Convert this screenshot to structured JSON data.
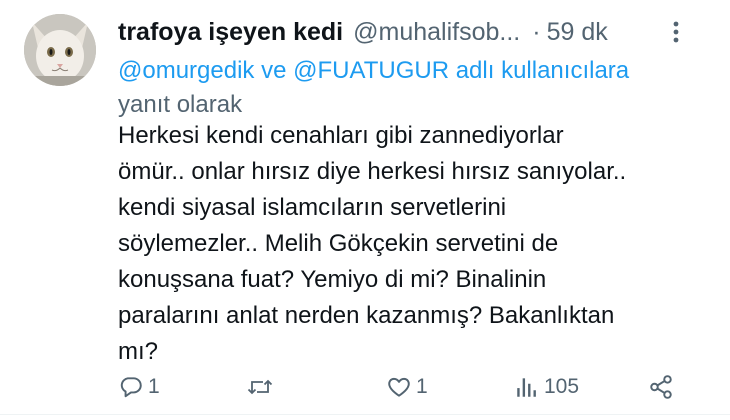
{
  "tweet": {
    "author_name": "trafoya işeyen kedi",
    "author_handle": "@muhalifsob...",
    "separator": "·",
    "time_ago": "59 dk",
    "reply_mention_1": "@omurgedik",
    "reply_conjunction": "ve",
    "reply_mention_2": "@FUATUGUR",
    "reply_suffix_colored": "adlı kullanıcılara",
    "reply_suffix": "yanıt olarak",
    "text": "Herkesi kendi cenahları gibi zannediyorlar\nömür.. onlar hırsız diye herkesi hırsız sanıyolar..\nkendi siyasal islamcıların servetlerini\nsöylemezler.. Melih Gökçekin servetini de\nkonuşsana fuat? Yemiyo di mi? Binalinin\nparalarını anlat nerden kazanmış? Bakanlıktan\nmı?"
  },
  "actions": {
    "reply_count": "1",
    "retweet_count": "",
    "like_count": "1",
    "views_count": "105"
  },
  "icons": {
    "avatar": "cat-avatar",
    "more": "more-vertical-icon",
    "reply": "reply-icon",
    "retweet": "retweet-icon",
    "like": "heart-icon",
    "views": "views-icon",
    "share": "share-icon"
  },
  "colors": {
    "text": "#0f1419",
    "secondary": "#536471",
    "link": "#1d9bf0"
  }
}
